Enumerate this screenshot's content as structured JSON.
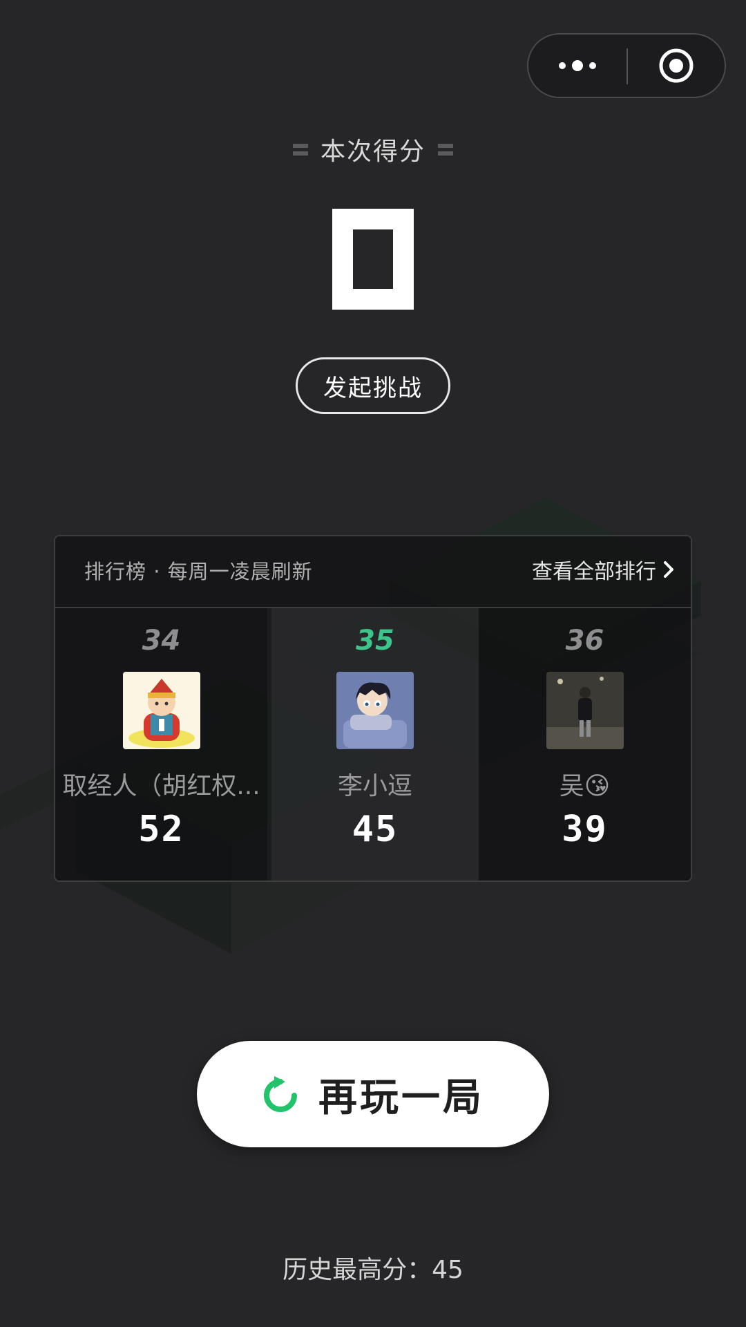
{
  "score": {
    "label": "本次得分",
    "value": "0"
  },
  "challenge_button": "发起挑战",
  "leaderboard": {
    "title": "排行榜 · 每周一凌晨刷新",
    "view_all": "查看全部排行",
    "entries": [
      {
        "rank": "34",
        "name": "取经人（胡红权...",
        "score": "52",
        "avatar": "monk-cartoon-avatar",
        "is_me": false
      },
      {
        "rank": "35",
        "name": "李小逗",
        "score": "45",
        "avatar": "anime-boy-avatar",
        "is_me": true
      },
      {
        "rank": "36",
        "name": "吴😘",
        "score": "39",
        "avatar": "photo-avatar",
        "is_me": false
      }
    ]
  },
  "replay_button": "再玩一局",
  "best_score_text": "历史最高分：45",
  "colors": {
    "background": "#262628",
    "accent_green": "#3cc48a",
    "text_primary": "#ffffff",
    "text_muted": "#9a9a9c"
  }
}
